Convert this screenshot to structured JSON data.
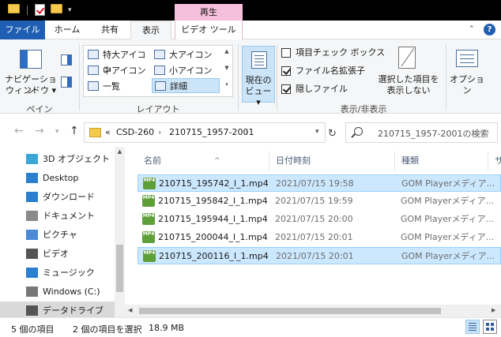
{
  "titlebar": {
    "context_tab": "再生"
  },
  "tabs": {
    "file": "ファイル",
    "home": "ホーム",
    "share": "共有",
    "view": "表示",
    "video_tools": "ビデオ ツール"
  },
  "ribbon": {
    "panes": {
      "nav_pane_label1": "ナビゲーション",
      "nav_pane_label2": "ウィンドウ ▾",
      "group": "ペイン"
    },
    "layout": {
      "group": "レイアウト",
      "items": [
        "特大アイコン",
        "大アイコン",
        "中アイコン",
        "小アイコン",
        "一覧",
        "詳細"
      ],
      "selected": "詳細"
    },
    "current_view": {
      "line1": "現在の",
      "line2": "ビュー ▾"
    },
    "show_hide": {
      "group": "表示/非表示",
      "item_checkbox": {
        "label": "項目チェック ボックス",
        "checked": false
      },
      "file_ext": {
        "label": "ファイル名拡張子",
        "checked": true
      },
      "hidden_items": {
        "label": "隠しファイル",
        "checked": true
      },
      "hide_selected_1": "選択した項目を",
      "hide_selected_2": "表示しない"
    },
    "options": "オプション"
  },
  "address": {
    "prefix": "«",
    "crumbs": [
      "CSD-260",
      "210715_1957-2001"
    ],
    "search_placeholder": "210715_1957-2001の検索"
  },
  "nav": {
    "items": [
      {
        "label": "3D オブジェクト",
        "icon": "3d-objects-icon",
        "color": "#3aa7d8"
      },
      {
        "label": "Desktop",
        "icon": "desktop-icon",
        "color": "#2b7fd1"
      },
      {
        "label": "ダウンロード",
        "icon": "download-icon",
        "color": "#2b7fd1"
      },
      {
        "label": "ドキュメント",
        "icon": "documents-icon",
        "color": "#8a8a8a"
      },
      {
        "label": "ピクチャ",
        "icon": "pictures-icon",
        "color": "#4a8ad6"
      },
      {
        "label": "ビデオ",
        "icon": "videos-icon",
        "color": "#555555"
      },
      {
        "label": "ミュージック",
        "icon": "music-icon",
        "color": "#2b7fd1"
      },
      {
        "label": "Windows (C:)",
        "icon": "drive-icon",
        "color": "#777777"
      },
      {
        "label": "データドライブ (D:)",
        "icon": "drive-icon",
        "color": "#555555"
      }
    ],
    "selected": 8
  },
  "columns": {
    "name": "名前",
    "date": "日付時刻",
    "type": "種類",
    "size": "サ"
  },
  "files": [
    {
      "name": "210715_195742_l_1.mp4",
      "date": "2021/07/15 19:58",
      "type": "GOM Playerメディア...",
      "selected": true
    },
    {
      "name": "210715_195842_l_1.mp4",
      "date": "2021/07/15 19:59",
      "type": "GOM Playerメディア...",
      "selected": false
    },
    {
      "name": "210715_195944_l_1.mp4",
      "date": "2021/07/15 20:00",
      "type": "GOM Playerメディア...",
      "selected": false
    },
    {
      "name": "210715_200044_l_1.mp4",
      "date": "2021/07/15 20:01",
      "type": "GOM Playerメディア...",
      "selected": false
    },
    {
      "name": "210715_200116_l_1.mp4",
      "date": "2021/07/15 20:01",
      "type": "GOM Playerメディア...",
      "selected": true
    }
  ],
  "file_icon_text": "MP4",
  "status": {
    "count": "5 個の項目",
    "selection": "2 個の項目を選択",
    "size": "18.9 MB"
  }
}
